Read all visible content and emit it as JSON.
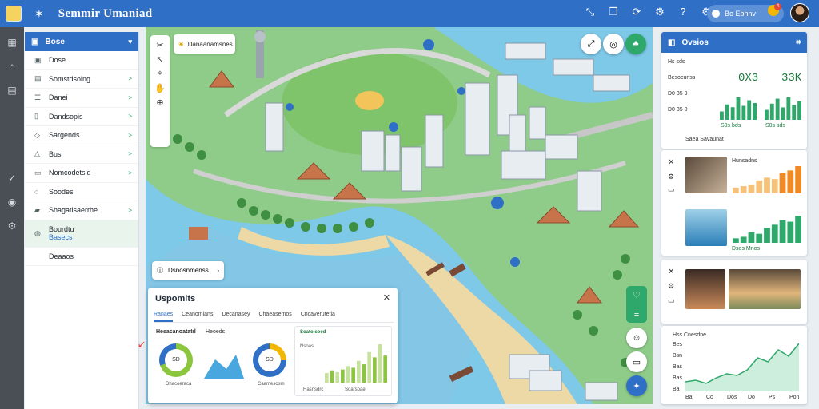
{
  "app": {
    "title": "Semmir Umaniad",
    "accent": "#2f6fc6",
    "user_label": "Bo Ebhnv",
    "notification_count": "4"
  },
  "rail": [
    "grid-icon",
    "home-icon",
    "layers-icon",
    "check-icon",
    "globe-icon",
    "settings-icon"
  ],
  "sidebar": {
    "header": "Bose",
    "items": [
      {
        "label": "Dose",
        "icon": "box-icon",
        "arrow": ""
      },
      {
        "label": "Somstdsoing",
        "icon": "chart-icon",
        "arrow": ">"
      },
      {
        "label": "Danei",
        "icon": "list-icon",
        "arrow": ">"
      },
      {
        "label": "Dandsopis",
        "icon": "doc-icon",
        "arrow": ">"
      },
      {
        "label": "Sargends",
        "icon": "tag-icon",
        "arrow": ">"
      },
      {
        "label": "Bus",
        "icon": "bus-icon",
        "arrow": ">"
      },
      {
        "label": "Nomcodetsid",
        "icon": "clip-icon",
        "arrow": ">"
      },
      {
        "label": "Soodes",
        "icon": "circle-icon",
        "arrow": ""
      },
      {
        "label": "Shagatisaerrhe",
        "icon": "folder-icon",
        "arrow": ">"
      },
      {
        "label": "Bourdtu",
        "icon": "leaf-icon",
        "arrow": "",
        "sub": "Basecs"
      },
      {
        "label": "Deaaos",
        "icon": "",
        "arrow": ""
      }
    ]
  },
  "map": {
    "search_label": "Danaanamsnes",
    "card_label": "Dsnosnmenss"
  },
  "panel": {
    "title": "Uspomits",
    "tabs": [
      "Ranaes",
      "Ceanomians",
      "Decanasey",
      "Chaeasemos",
      "Cncaverutetia"
    ],
    "sub_left": "Hesacanoatatd",
    "sub_mid": "Heoeds",
    "donut_a_value": "SD",
    "donut_b_value": "SD",
    "cap_a": "Dhacoeraca",
    "cap_b": "Caamesosm",
    "mini_title": "Soatoicoed",
    "mini_sub": "Nsoas",
    "mini_values": [
      22,
      28,
      24,
      30,
      38,
      34,
      50,
      42,
      70,
      58,
      88,
      62
    ],
    "mini_labels": [
      "Hasnsdrc",
      "Soarsoae"
    ]
  },
  "right": {
    "card1": {
      "title": "Ovsios",
      "rows": [
        {
          "label": "Hs sds",
          "value": ""
        },
        {
          "label": "Besocunss",
          "value": ""
        },
        {
          "label": "D0 35 9",
          "value": ""
        },
        {
          "label": "D0 35 0",
          "value": ""
        }
      ],
      "stat_a": "0X3",
      "stat_b": "33K",
      "bars_a": [
        30,
        55,
        45,
        80,
        50,
        70,
        60
      ],
      "bars_b": [
        40,
        65,
        85,
        50,
        90,
        60,
        75
      ],
      "foot_a": "S0s bds",
      "foot_b": "S0s sds"
    },
    "card2_label": "Saea Savaunat",
    "card2": {
      "title": "Hunsadns",
      "bars": [
        20,
        25,
        30,
        45,
        55,
        50,
        70,
        80,
        95
      ],
      "bars2": [
        15,
        20,
        35,
        30,
        50,
        60,
        75,
        70,
        90
      ],
      "foot": "Dsos Mnos"
    },
    "card3": {
      "title": "Hss Cnesdne",
      "series": [
        30,
        32,
        28,
        35,
        40,
        38,
        45,
        60,
        55,
        70,
        62,
        78
      ],
      "yticks": [
        "Bes",
        "Bsn",
        "Bas",
        "Bas",
        "Ba"
      ],
      "xticks": [
        "Ba",
        "Co",
        "Dos",
        "Do",
        "Ps",
        "Pon"
      ]
    }
  }
}
